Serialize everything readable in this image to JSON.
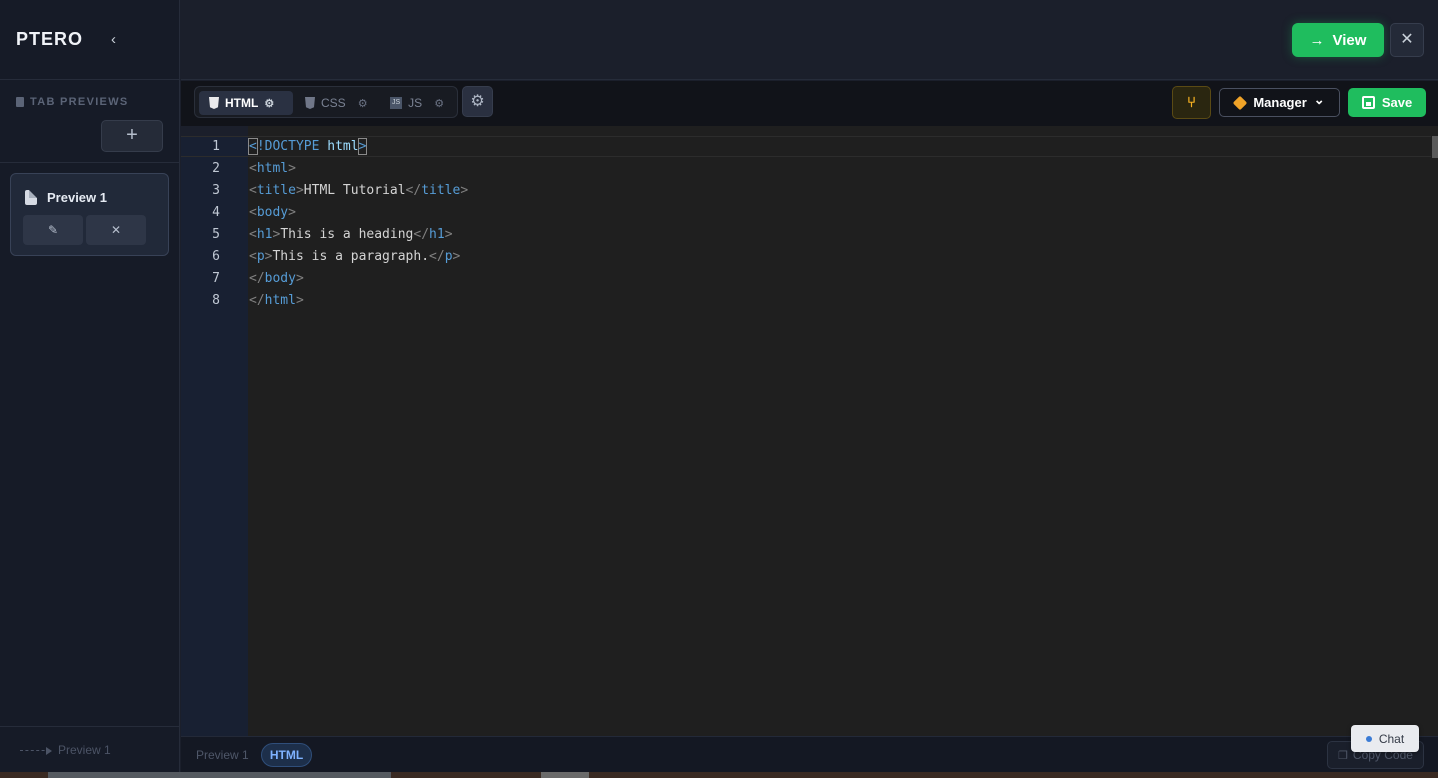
{
  "sidebar": {
    "brand": "PTERO",
    "collapse_icon": "‹",
    "section_title": "TAB PREVIEWS",
    "add_label": "+",
    "preview_card": {
      "title": "Preview 1",
      "edit_icon": "✎",
      "close_icon": "✕"
    },
    "footer_label": "Preview 1"
  },
  "topbar": {
    "view_label": "View",
    "view_arrow": "→",
    "close_icon": "✕"
  },
  "toolbar": {
    "tabs": [
      {
        "label": "HTML",
        "gear": "⚙"
      },
      {
        "label": "CSS",
        "gear": "⚙"
      },
      {
        "label": "JS",
        "badge": "JS",
        "gear": "⚙"
      }
    ],
    "settings_icon": "⚙",
    "branch_icon": "⑂",
    "manager_label": "Manager",
    "manager_chevron": "⌄",
    "save_label": "Save"
  },
  "editor": {
    "line_numbers": [
      "1",
      "2",
      "3",
      "4",
      "5",
      "6",
      "7",
      "8"
    ],
    "lines": [
      {
        "open": "<",
        "kw": "!DOCTYPE",
        "text": " html",
        "close": ">"
      },
      {
        "open": "<",
        "tag": "html",
        "close": ">"
      },
      {
        "open": "<",
        "tag": "title",
        "close": ">",
        "text": "HTML Tutorial",
        "end": "</",
        "endtag": "title",
        "endclose": ">"
      },
      {
        "open": "<",
        "tag": "body",
        "close": ">"
      },
      {
        "open": "<",
        "tag": "h1",
        "close": ">",
        "text": "This is a heading",
        "end": "</",
        "endtag": "h1",
        "endclose": ">"
      },
      {
        "open": "<",
        "tag": "p",
        "close": ">",
        "text": "This is a paragraph.",
        "end": "</",
        "endtag": "p",
        "endclose": ">"
      },
      {
        "open": "</",
        "tag": "body",
        "close": ">"
      },
      {
        "open": "</",
        "tag": "html",
        "close": ">"
      }
    ]
  },
  "statusbar": {
    "preview_label": "Preview 1",
    "mode_label": "HTML",
    "copy_label": "Copy Code",
    "chat_label": "Chat"
  },
  "colors": {
    "accent_green": "#1fbd5e",
    "tag_blue": "#569cd6",
    "manager_orange": "#f0a328"
  }
}
